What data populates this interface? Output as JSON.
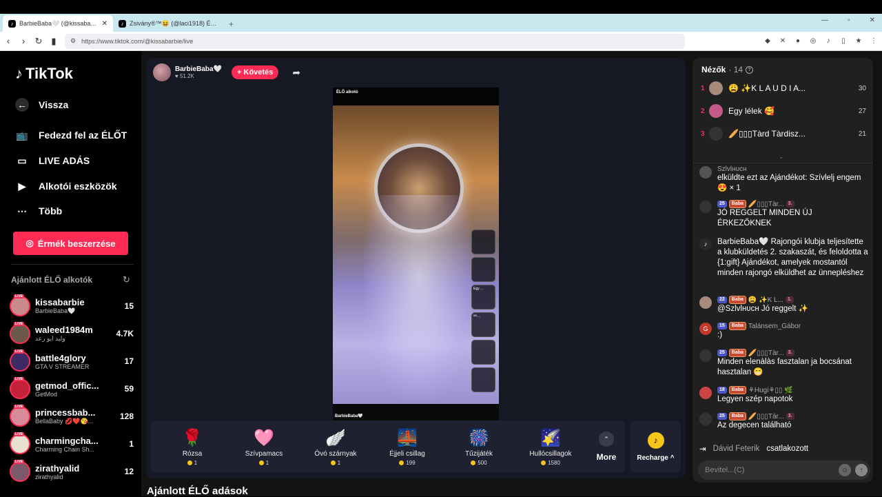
{
  "browser": {
    "tabs": [
      {
        "title": "BarbieBaba🤍 (@kissabarbie",
        "active": true
      },
      {
        "title": "Zsivány®™😆 (@laci1918) ÉLŐ adás",
        "active": false
      }
    ],
    "url": "https://www.tiktok.com/@kissabarbie/live"
  },
  "sidebar": {
    "logo": "TikTok",
    "back": "Vissza",
    "nav": [
      "Fedezd fel az ÉLŐT",
      "LIVE ADÁS",
      "Alkotói eszközök",
      "Több"
    ],
    "coins_button": "Érmék beszerzése",
    "recommended_title": "Ajánlott ÉLŐ alkotók",
    "live_tag": "LIVE",
    "creators": [
      {
        "name": "kissabarbie",
        "sub": "BarbieBaba🤍",
        "count": "15",
        "color": "#c88a8a"
      },
      {
        "name": "waleed1984m",
        "sub": "وليد ابو رعد",
        "count": "4.7K",
        "color": "#6b5a4a"
      },
      {
        "name": "battle4glory",
        "sub": "GTA V STREAMER",
        "count": "17",
        "color": "#3d2b66"
      },
      {
        "name": "getmod_offic...",
        "sub": "GetMod",
        "count": "59",
        "color": "#c4213a"
      },
      {
        "name": "princessbab...",
        "sub": "BellaBaby 💋❤️😘...",
        "count": "128",
        "color": "#d68a9a"
      },
      {
        "name": "charmingcha...",
        "sub": "Charming Chain Sh...",
        "count": "1",
        "color": "#e8e0d0"
      },
      {
        "name": "zirathyalid",
        "sub": "zirathyalid",
        "count": "12",
        "color": "#7a5a6a"
      }
    ]
  },
  "stream": {
    "host_name": "BarbieBaba🤍",
    "host_likes": "51.2K",
    "follow_label": "+ Követés",
    "video_top_label": "ÉLŐ alkotó",
    "video_bottom_label": "BarbieBaba🤍",
    "mini_gift_labels": [
      "",
      "",
      "Egy ...",
      "ᴰᴱᴸ...",
      "",
      ""
    ]
  },
  "gifts": [
    {
      "name": "Rózsa",
      "price": "1",
      "icon": "🌹"
    },
    {
      "name": "Szívpamacs",
      "price": "1",
      "icon": "🩷"
    },
    {
      "name": "Óvó szárnyak",
      "price": "1",
      "icon": "🪽"
    },
    {
      "name": "Éjjeli csillag",
      "price": "199",
      "icon": "🌉"
    },
    {
      "name": "Tűzijáték",
      "price": "500",
      "icon": "🎆"
    },
    {
      "name": "Hullócsillagok",
      "price": "1580",
      "icon": "🌠"
    }
  ],
  "more_label": "More",
  "recharge_label": "Recharge ^",
  "recommended_streams": "Ajánlott ÉLŐ adások",
  "chat": {
    "viewers_title": "Nézők",
    "viewer_count": "14",
    "viewers": [
      {
        "rank": "1",
        "name": "😩 ✨K L A U D I A...",
        "score": "30",
        "color": "#a88a7a"
      },
      {
        "rank": "2",
        "name": "Egy lélek 🥰",
        "score": "27",
        "color": "#c45a8a"
      },
      {
        "rank": "3",
        "name": "🥖▯▯▯Tàrd Tàrdisz...",
        "score": "21",
        "color": "#333"
      }
    ],
    "messages": [
      {
        "head": "Szlvlнυcн",
        "text": "elküldte ezt az Ajándékot: Szívlelj engem 😍 × 1",
        "color": "#555",
        "badges": []
      },
      {
        "head": "🥖▯▯▯Tàr...",
        "text": "JÓ REGGELT MINDEN ÚJ ÉRKEZŐKNEK",
        "color": "#333",
        "badges": [
          "25",
          "Baba",
          "3."
        ]
      },
      {
        "head": "",
        "text": "BarbieBaba🤍 Rajongói klubja teljesítette a klubküldetés 2. szakaszát, és feloldotta a {1:gift} Ajándékot, amelyek mostantól minden rajongó elküldhet az ünnepléshez",
        "color": "#2a2a2a",
        "badges": []
      },
      {
        "head": "😩 ✨K L...",
        "text": "@Szlvlнυcн Jó reggelt ✨",
        "color": "#a88a7a",
        "badges": [
          "22",
          "Baba",
          "1."
        ]
      },
      {
        "head": "Talánsem_Gábor",
        "text": ":)",
        "color": "#c0392b",
        "badges": [
          "15",
          "Baba"
        ]
      },
      {
        "head": "🥖▯▯▯Tàr...",
        "text": "Minden elenàlàs fasztalan ja bocsánat hasztalan 😁",
        "color": "#333",
        "badges": [
          "25",
          "Baba",
          "3."
        ]
      },
      {
        "head": "⚘Hugi⚘▯▯ 🌿",
        "text": "Legyen szép napotok",
        "color": "#c44",
        "badges": [
          "18",
          "Baba"
        ]
      },
      {
        "head": "🥖▯▯▯Tàr...",
        "text": "Az degecen található",
        "color": "#333",
        "badges": [
          "25",
          "Baba",
          "3."
        ]
      }
    ],
    "joined_name": "Dávid Feterik",
    "joined_text": "csatlakozott",
    "input_placeholder": "Bevitel...(C)"
  }
}
